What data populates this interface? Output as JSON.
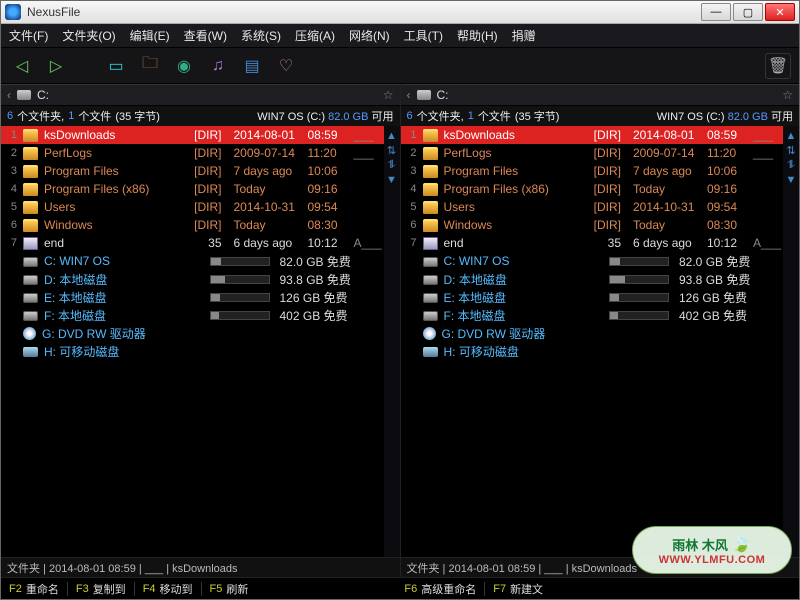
{
  "app": {
    "title": "NexusFile"
  },
  "menu": [
    "文件(F)",
    "文件夹(O)",
    "编辑(E)",
    "查看(W)",
    "系统(S)",
    "压缩(A)",
    "网络(N)",
    "工具(T)",
    "帮助(H)",
    "捐赠"
  ],
  "path": "C:",
  "summary": {
    "folders_n": "6",
    "folders_t": "个文件夹,",
    "files_n": "1",
    "files_t": "个文件",
    "bytes": "(35 字节)",
    "drive_label": "WIN7 OS (C:)",
    "free_n": "82.0 GB",
    "free_t": "可用"
  },
  "rows": [
    {
      "sel": true,
      "kind": "folder",
      "cls": "orange",
      "name": "ksDownloads",
      "tag": "[DIR]",
      "date": "2014-08-01",
      "time": "08:59",
      "attr": "___"
    },
    {
      "kind": "folder",
      "cls": "orange",
      "name": "PerfLogs",
      "tag": "[DIR]",
      "date": "2009-07-14",
      "time": "11:20",
      "attr": "___"
    },
    {
      "kind": "folder",
      "cls": "orange",
      "name": "Program Files",
      "tag": "[DIR]",
      "date": "7 days ago",
      "time": "10:06",
      "attr": ""
    },
    {
      "kind": "folder",
      "cls": "orange",
      "name": "Program Files (x86)",
      "tag": "[DIR]",
      "date": "Today",
      "time": "09:16",
      "attr": ""
    },
    {
      "kind": "folder",
      "cls": "orange",
      "name": "Users",
      "tag": "[DIR]",
      "date": "2014-10-31",
      "time": "09:54",
      "attr": ""
    },
    {
      "kind": "folder",
      "cls": "orange",
      "name": "Windows",
      "tag": "[DIR]",
      "date": "Today",
      "time": "08:30",
      "attr": ""
    },
    {
      "kind": "file",
      "cls": "white",
      "name": "end",
      "tag": "35",
      "date": "6 days ago",
      "time": "10:12",
      "attr": "A___"
    },
    {
      "kind": "hdd",
      "cls": "drive",
      "name": "C: WIN7 OS",
      "pct": 18,
      "free": "82.0 GB 免费"
    },
    {
      "kind": "hdd",
      "cls": "drive",
      "name": "D: 本地磁盘",
      "pct": 25,
      "free": "93.8 GB 免费"
    },
    {
      "kind": "hdd",
      "cls": "drive",
      "name": "E: 本地磁盘",
      "pct": 16,
      "free": "126 GB 免费"
    },
    {
      "kind": "hdd",
      "cls": "drive",
      "name": "F: 本地磁盘",
      "pct": 14,
      "free": "402 GB 免费"
    },
    {
      "kind": "cd",
      "cls": "drive",
      "name": "G: DVD RW 驱动器",
      "pct": null,
      "free": ""
    },
    {
      "kind": "usb",
      "cls": "drive",
      "name": "H: 可移动磁盘",
      "pct": null,
      "free": ""
    }
  ],
  "status": "文件夹 | 2014-08-01 08:59 | ___ | ksDownloads",
  "fkeys_left": [
    {
      "k": "F2",
      "l": "重命名"
    },
    {
      "k": "F3",
      "l": "复制到"
    },
    {
      "k": "F4",
      "l": "移动到"
    },
    {
      "k": "F5",
      "l": "刷新"
    }
  ],
  "fkeys_right": [
    {
      "k": "F6",
      "l": "高级重命名"
    },
    {
      "k": "F7",
      "l": "新建文"
    }
  ],
  "watermark": {
    "t1": "雨林 木风",
    "t2": "WWW.YLMFU.COM"
  }
}
